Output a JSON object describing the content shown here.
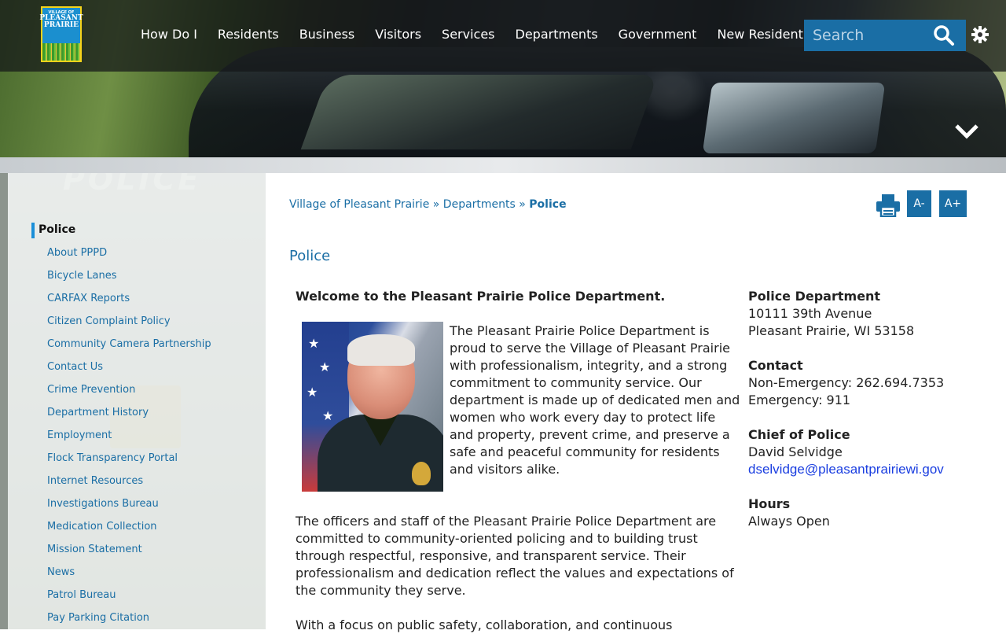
{
  "logo": {
    "line1": "VILLAGE OF",
    "line2": "PLEASANT",
    "line3": "PRAIRIE"
  },
  "nav": [
    "How Do I",
    "Residents",
    "Business",
    "Visitors",
    "Services",
    "Departments",
    "Government",
    "New Resident"
  ],
  "search": {
    "placeholder": "Search"
  },
  "sidebar": {
    "current": "Police",
    "items": [
      "About PPPD",
      "Bicycle Lanes",
      "CARFAX Reports",
      "Citizen Complaint Policy",
      "Community Camera Partnership",
      "Contact Us",
      "Crime Prevention",
      "Department History",
      "Employment",
      "Flock Transparency Portal",
      "Internet Resources",
      "Investigations Bureau",
      "Medication Collection",
      "Mission Statement",
      "News",
      "Patrol Bureau",
      "Pay Parking Citation"
    ]
  },
  "breadcrumb": {
    "home": "Village of Pleasant Prairie",
    "sep1": "»",
    "parent": "Departments",
    "sep2": "»",
    "current": "Police"
  },
  "tools": {
    "decrease": "A-",
    "increase": "A+"
  },
  "page": {
    "title": "Police",
    "welcome": "Welcome to the Pleasant Prairie Police Department.",
    "intro": "The Pleasant Prairie Police Department is proud to serve the Village of Pleasant Prairie with professionalism, integrity, and a strong commitment to community service. Our department is made up of dedicated men and women who work every day to protect life and property, prevent crime, and preserve a safe and peaceful community for residents and visitors alike.",
    "para2": "The officers and staff of the Pleasant Prairie Police Department are committed to community-oriented policing and to building trust through respectful, responsive, and transparent service. Their professionalism and dedication reflect the values and expectations of the community they serve.",
    "para3": "With a focus on public safety, collaboration, and continuous"
  },
  "info": {
    "dept_heading": "Police Department",
    "address1": "10111 39th Avenue",
    "address2": "Pleasant Prairie, WI 53158",
    "contact_heading": "Contact",
    "non_emergency": "Non-Emergency: 262.694.7353",
    "emergency": "Emergency: 911",
    "chief_heading": "Chief of Police",
    "chief_name": "David Selvidge",
    "chief_email": "dselvidge@pleasantprairiewi.gov",
    "hours_heading": "Hours",
    "hours": "Always Open"
  },
  "icons": [
    "print-icon",
    "search-icon",
    "gear-icon",
    "chevron-down-icon"
  ],
  "colors": {
    "accent": "#1a6ea5",
    "email": "#1a3ee0",
    "current_marker": "#1a8fd8"
  }
}
